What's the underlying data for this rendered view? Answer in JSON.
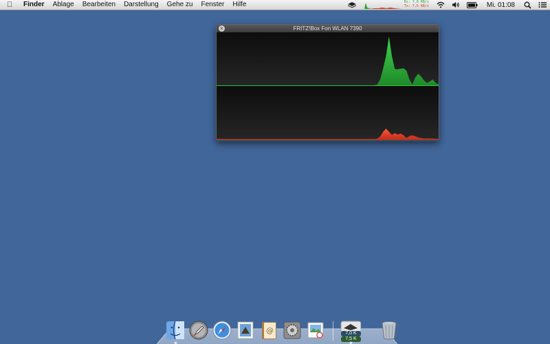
{
  "menubar": {
    "apple_icon": "apple-logo-icon",
    "items": [
      {
        "label": "Finder",
        "bold": true
      },
      {
        "label": "Ablage"
      },
      {
        "label": "Bearbeiten"
      },
      {
        "label": "Darstellung"
      },
      {
        "label": "Gehe zu"
      },
      {
        "label": "Fenster"
      },
      {
        "label": "Hilfe"
      }
    ],
    "netmeter": {
      "rx_label": "Rx: 7,0 KB/s",
      "tx_label": "Tx: 7,5 KB/s"
    },
    "clock": "Mi. 01:08",
    "tray_icons": [
      "fritzbox-icon",
      "network-meter",
      "wifi-icon",
      "volume-icon",
      "battery-icon",
      "spotlight-icon",
      "notification-list-icon"
    ]
  },
  "widget": {
    "title": "FRITZ!Box Fon WLAN 7390",
    "download_series": [
      0,
      0,
      0,
      0,
      0,
      0,
      0,
      0,
      0,
      0,
      0,
      0,
      0,
      0,
      0,
      0,
      0,
      0,
      0,
      0,
      0,
      0,
      0,
      0,
      0,
      0,
      0,
      0,
      0,
      0,
      0,
      0,
      0,
      0,
      0,
      0,
      0,
      0,
      0,
      0,
      0,
      0,
      0,
      0,
      0,
      0,
      0,
      0,
      0,
      0,
      0,
      0,
      0,
      0,
      0,
      0.02,
      0.12,
      0.35,
      0.6,
      1.0,
      0.6,
      0.33,
      0.33,
      0.34,
      0.35,
      0.3,
      0.12,
      0.02,
      0.16,
      0.24,
      0.18,
      0.1,
      0.05,
      0.08,
      0.12,
      0.05,
      0.02
    ],
    "upload_series": [
      0,
      0,
      0,
      0,
      0,
      0,
      0,
      0,
      0,
      0,
      0,
      0,
      0,
      0,
      0,
      0,
      0,
      0,
      0,
      0,
      0,
      0,
      0,
      0,
      0,
      0,
      0,
      0,
      0,
      0,
      0,
      0,
      0,
      0,
      0,
      0,
      0,
      0,
      0,
      0,
      0,
      0,
      0,
      0,
      0,
      0,
      0,
      0,
      0,
      0,
      0,
      0,
      0,
      0,
      0,
      0.02,
      0.12,
      0.35,
      0.5,
      0.35,
      0.2,
      0.28,
      0.22,
      0.26,
      0.18,
      0.05,
      0.14,
      0.18,
      0.13,
      0.08,
      0.04,
      0.02,
      0.03,
      0.02,
      0.02,
      0.01,
      0.01
    ],
    "download_color": "#2fbe3c",
    "upload_color": "#e8492e"
  },
  "dock": {
    "apps": [
      {
        "name": "Finder",
        "icon": "finder-icon",
        "running": true
      },
      {
        "name": "Launchpad",
        "icon": "launchpad-rocket-icon",
        "running": false
      },
      {
        "name": "Safari",
        "icon": "safari-compass-icon",
        "running": false
      },
      {
        "name": "Mail",
        "icon": "mail-stamp-icon",
        "running": false
      },
      {
        "name": "Adressbuch",
        "icon": "address-book-icon",
        "running": false
      },
      {
        "name": "Systemeinstellungen",
        "icon": "system-preferences-icon",
        "running": false
      },
      {
        "name": "Vorschau",
        "icon": "preview-icon",
        "running": false
      },
      {
        "name": "FRITZ!Box Monitor",
        "icon": "fritzbox-monitor-icon",
        "running": true,
        "badge_rx": "7,0 K",
        "badge_tx": "7,5 K"
      }
    ],
    "trash": {
      "name": "Papierkorb",
      "icon": "trash-icon"
    }
  }
}
